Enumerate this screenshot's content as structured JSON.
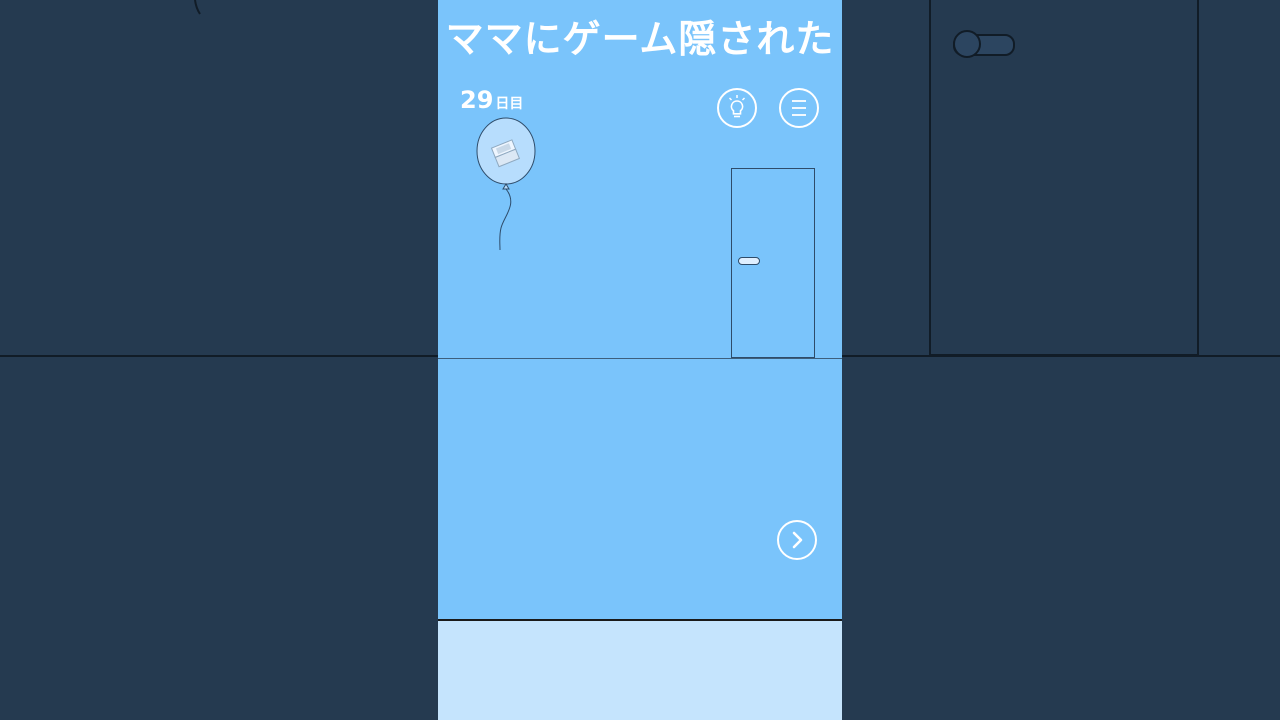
{
  "title": "ママにゲーム隠された",
  "day": {
    "number": "29",
    "unit": "日目"
  },
  "buttons": {
    "hint_icon": "lightbulb-icon",
    "menu_icon": "hamburger-menu-icon",
    "next_icon": "chevron-right-icon"
  },
  "scene": {
    "items": [
      "balloon-with-game-console",
      "door"
    ]
  },
  "colors": {
    "sky": "#7ac4fb",
    "bottom": "#c5e4fd",
    "side_background": "#253a50",
    "ui_white": "#ffffff"
  }
}
